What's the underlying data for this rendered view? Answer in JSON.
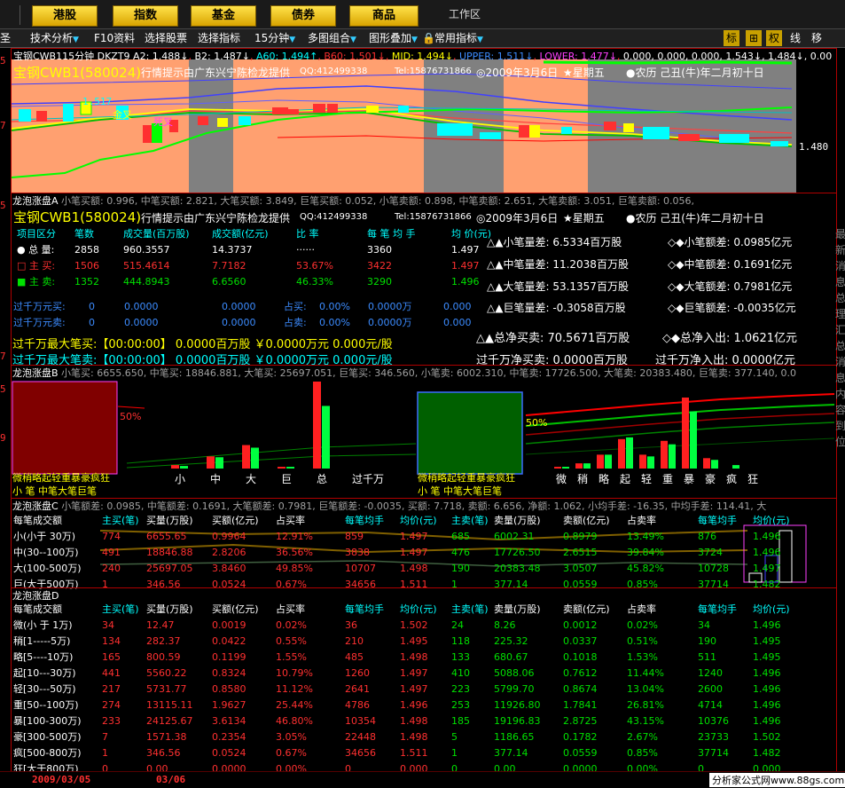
{
  "nav": {
    "items": [
      "港股",
      "指数",
      "基金",
      "债券",
      "商品"
    ],
    "workspace": "工作区"
  },
  "toolbar": {
    "items": [
      "技术分析",
      "F10资料",
      "选择股票",
      "选择指标",
      "15分钟",
      "多图组合",
      "图形叠加",
      "常用指标"
    ],
    "right_icons": [
      "标",
      "⊞",
      "权",
      "线",
      "移"
    ]
  },
  "chart1": {
    "indicator_line": {
      "name": "宝钢CWB115分钟",
      "a": "DKZT9",
      "a2": "A2: 1.488↓",
      "b2": "B2: 1.487↓",
      "a60": "A60: 1.494↑",
      "b60": "B60: 1.501↓",
      "mid": "MID: 1.494↓",
      "upper": "UPPER: 1.511↓",
      "lower": "LOWER: 1.477↓",
      "extra": "0.000, 0.000, 0.000, 1.543↓, 1.484↓, 0.00"
    },
    "stock_title": "宝钢CWB1(580024)",
    "provider": "行情提示由广东兴宁陈检龙提供",
    "qq": "QQ:412499338",
    "tel": "Tel:15876731866",
    "date": "◎2009年3月6日",
    "weekday": "★星期五",
    "lunar": "●农历 己丑(牛)年二月初十日",
    "price_high": "1.517",
    "price_low": "1.480",
    "label_gold": "金叉",
    "label_dead": "死叉",
    "label_gold2": "金叉",
    "y_ticks": [
      "5",
      "7"
    ]
  },
  "panelA": {
    "header": "龙泡涨盘A",
    "header_vals": "小笔买额: 0.996, 中笔买额: 2.821, 大笔买额: 3.849, 巨笔买额: 0.052, 小笔卖额: 0.898, 中笔卖额: 2.651, 大笔卖额: 3.051, 巨笔卖额: 0.056,",
    "stock_title": "宝钢CWB1(580024)",
    "provider": "行情提示由广东兴宁陈检龙提供",
    "qq": "QQ:412499338",
    "tel": "Tel:15876731866",
    "date": "◎2009年3月6日",
    "weekday": "★星期五",
    "lunar": "●农历 己丑(牛)年二月初十日",
    "col_headers": [
      "项目区分",
      "笔数",
      "成交量(百万股)",
      "成交额(亿元)",
      "比 率",
      "每 笔 均 手",
      "均 价(元)"
    ],
    "rows": [
      {
        "icon": "●",
        "name": "总 量:",
        "count": "2858",
        "vol": "960.3557",
        "amt": "14.3737",
        "ratio": "······",
        "avg": "3360",
        "price": "1.497"
      },
      {
        "icon": "□",
        "name": "主 买:",
        "count": "1506",
        "vol": "515.4614",
        "amt": "7.7182",
        "ratio": "53.67%",
        "avg": "3422",
        "price": "1.497"
      },
      {
        "icon": "■",
        "name": "主 卖:",
        "count": "1352",
        "vol": "444.8943",
        "amt": "6.6560",
        "ratio": "46.33%",
        "avg": "3290",
        "price": "1.496"
      }
    ],
    "kilo_rows": [
      {
        "name": "过千万元买:",
        "count": "0",
        "vol": "0.0000",
        "amt": "0.0000",
        "lbl": "占买:",
        "ratio": "0.00%",
        "wan": "0.0000万",
        "price": "0.000"
      },
      {
        "name": "过千万元卖:",
        "count": "0",
        "vol": "0.0000",
        "amt": "0.0000",
        "lbl": "占卖:",
        "ratio": "0.00%",
        "wan": "0.0000万",
        "price": "0.000"
      }
    ],
    "max_buy": "过千万最大笔买:【00:00:00】   0.0000百万股  ￥0.0000万元   0.000元/股",
    "max_sell": "过千万最大笔卖:【00:00:00】   0.0000百万股  ￥0.0000万元   0.000元/股",
    "diffs": [
      {
        "l": "△▲小笔量差: 6.5334百万股",
        "r": "◇◆小笔额差: 0.0985亿元"
      },
      {
        "l": "△▲中笔量差: 11.2038百万股",
        "r": "◇◆中笔额差: 0.1691亿元"
      },
      {
        "l": "△▲大笔量差: 53.1357百万股",
        "r": "◇◆大笔额差: 0.7981亿元"
      },
      {
        "l": "△▲巨笔量差: -0.3058百万股",
        "r": "◇◆巨笔额差: -0.0035亿元"
      }
    ],
    "net_buy": "△▲总净买卖: 70.5671百万股",
    "net_flow": "◇◆总净入出: 1.0621亿元",
    "kilo_net_buy": "过千万净买卖: 0.0000百万股",
    "kilo_net_flow": "过千万净入出: 0.0000亿元"
  },
  "panelB": {
    "header": "龙泡涨盘B",
    "header_vals": "小笔买: 6655.650, 中笔买: 18846.881, 大笔买: 25697.051, 巨笔买: 346.560, 小笔卖: 6002.310, 中笔卖: 17726.500, 大笔卖: 20383.480, 巨笔卖: 377.140, 0.0",
    "pct_label": "50%",
    "pct_label2": "50%",
    "box_labels": "微稍略起轻重暴豪疯狂",
    "box_sub": "小 笔 中笔大笔巨笔",
    "box_sub2": "小 笔 中笔大笔巨笔",
    "bar_labels1": [
      "小",
      "中",
      "大",
      "巨",
      "总",
      "过千万"
    ],
    "bar_labels2": [
      "微",
      "稍",
      "略",
      "起",
      "轻",
      "重",
      "暴",
      "豪",
      "疯",
      "狂"
    ],
    "bars1": {
      "buy": [
        4,
        14,
        27,
        2,
        100
      ],
      "sell": [
        3,
        13,
        24,
        2,
        72
      ]
    },
    "bars2": {
      "buy": [
        1,
        3,
        8,
        17,
        8,
        16,
        41,
        6,
        0,
        0
      ],
      "sell": [
        1,
        3,
        8,
        18,
        7,
        14,
        33,
        5,
        2,
        0
      ]
    }
  },
  "panelC": {
    "header": "龙泡涨盘C",
    "header_vals": "小笔额差: 0.0985, 中笔额差: 0.1691, 大笔额差: 0.7981, 巨笔额差: -0.0035, 买额: 7.718, 卖额: 6.656, 净额: 1.062, 小均手差: -16.35, 中均手差: 114.41, 大",
    "cols": [
      "每笔成交额",
      "主买(笔)",
      "买量(万股)",
      "买额(亿元)",
      "占买率",
      "每笔均手",
      "均价(元)",
      "主卖(笔)",
      "卖量(万股)",
      "卖额(亿元)",
      "占卖率",
      "每笔均手",
      "均价(元)"
    ],
    "rows": [
      [
        "小(小于 30万)",
        "774",
        "6655.65",
        "0.9964",
        "12.91%",
        "859",
        "1.497",
        "685",
        "6002.31",
        "0.8979",
        "13.49%",
        "876",
        "1.496"
      ],
      [
        "中(30--100万)",
        "491",
        "18846.88",
        "2.8206",
        "36.56%",
        "3838",
        "1.497",
        "476",
        "17726.50",
        "2.6515",
        "39.84%",
        "3724",
        "1.496"
      ],
      [
        "大(100-500万)",
        "240",
        "25697.05",
        "3.8460",
        "49.85%",
        "10707",
        "1.498",
        "190",
        "20383.48",
        "3.0507",
        "45.82%",
        "10728",
        "1.497"
      ],
      [
        "巨(大于500万)",
        "1",
        "346.56",
        "0.0524",
        "0.67%",
        "34656",
        "1.511",
        "1",
        "377.14",
        "0.0559",
        "0.85%",
        "37714",
        "1.482"
      ]
    ]
  },
  "panelD": {
    "header": "龙泡涨盘D",
    "cols": [
      "每笔成交额",
      "主买(笔)",
      "买量(万股)",
      "买额(亿元)",
      "占买率",
      "每笔均手",
      "均价(元)",
      "主卖(笔)",
      "卖量(万股)",
      "卖额(亿元)",
      "占卖率",
      "每笔均手",
      "均价(元)"
    ],
    "rows": [
      [
        "微(小 于 1万)",
        "34",
        "12.47",
        "0.0019",
        "0.02%",
        "36",
        "1.502",
        "24",
        "8.26",
        "0.0012",
        "0.02%",
        "34",
        "1.496"
      ],
      [
        "稍[1-----5万)",
        "134",
        "282.37",
        "0.0422",
        "0.55%",
        "210",
        "1.495",
        "118",
        "225.32",
        "0.0337",
        "0.51%",
        "190",
        "1.495"
      ],
      [
        "略[5----10万)",
        "165",
        "800.59",
        "0.1199",
        "1.55%",
        "485",
        "1.498",
        "133",
        "680.67",
        "0.1018",
        "1.53%",
        "511",
        "1.495"
      ],
      [
        "起[10---30万)",
        "441",
        "5560.22",
        "0.8324",
        "10.79%",
        "1260",
        "1.497",
        "410",
        "5088.06",
        "0.7612",
        "11.44%",
        "1240",
        "1.496"
      ],
      [
        "轻[30---50万)",
        "217",
        "5731.77",
        "0.8580",
        "11.12%",
        "2641",
        "1.497",
        "223",
        "5799.70",
        "0.8674",
        "13.04%",
        "2600",
        "1.496"
      ],
      [
        "重[50--100万)",
        "274",
        "13115.11",
        "1.9627",
        "25.44%",
        "4786",
        "1.496",
        "253",
        "11926.80",
        "1.7841",
        "26.81%",
        "4714",
        "1.496"
      ],
      [
        "暴[100-300万)",
        "233",
        "24125.67",
        "3.6134",
        "46.80%",
        "10354",
        "1.498",
        "185",
        "19196.83",
        "2.8725",
        "43.15%",
        "10376",
        "1.496"
      ],
      [
        "豪[300-500万)",
        "7",
        "1571.38",
        "0.2354",
        "3.05%",
        "22448",
        "1.498",
        "5",
        "1186.65",
        "0.1782",
        "2.67%",
        "23733",
        "1.502"
      ],
      [
        "疯[500-800万)",
        "1",
        "346.56",
        "0.0524",
        "0.67%",
        "34656",
        "1.511",
        "1",
        "377.14",
        "0.0559",
        "0.85%",
        "37714",
        "1.482"
      ],
      [
        "狂[大于800万)",
        "0",
        "0.00",
        "0.0000",
        "0.00%",
        "0",
        "0.000",
        "0",
        "0.00",
        "0.0000",
        "0.00%",
        "0",
        "0.000"
      ]
    ]
  },
  "right_label": "最新消息总理汇总消息内容到位",
  "status": {
    "date1": "2009/03/05",
    "date2": "03/06",
    "watermark": "分析家公式网www.88gs.com"
  }
}
